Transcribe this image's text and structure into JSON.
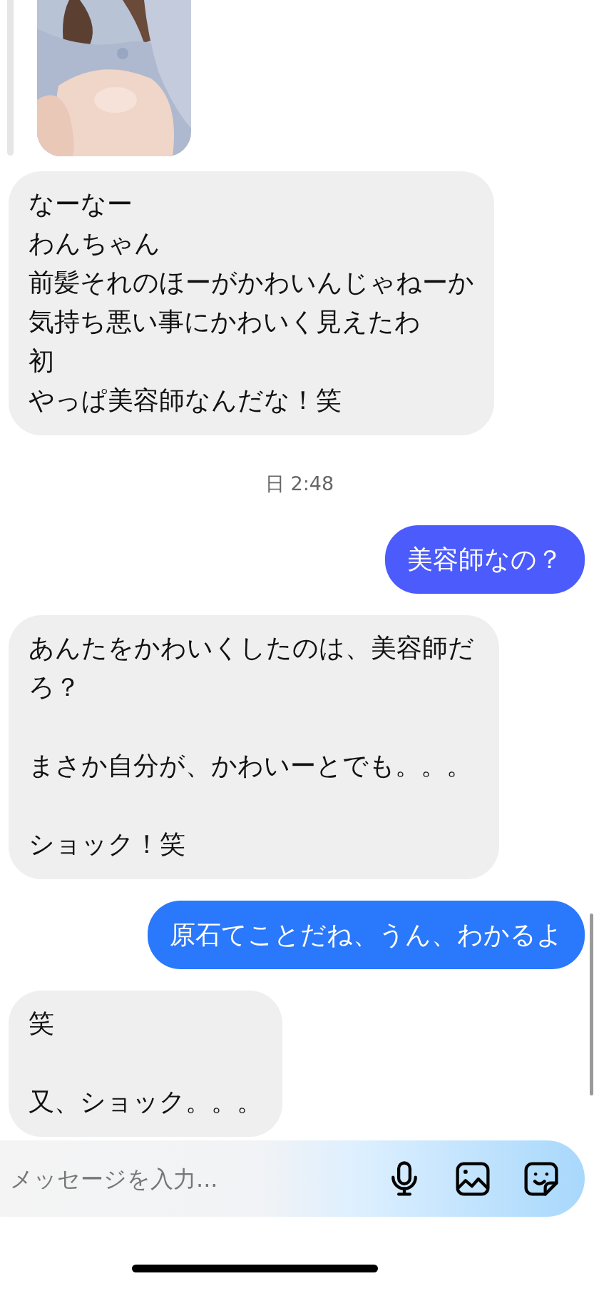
{
  "messages": [
    {
      "kind": "picture"
    },
    {
      "kind": "received",
      "paragraphs": [
        [
          "なーなー",
          "わんちゃん",
          "前髪それのほーがかわいんじゃねーか",
          "気持ち悪い事にかわいく見えたわ",
          "初",
          "やっぱ美容師なんだな！笑"
        ]
      ]
    },
    {
      "kind": "timestamp",
      "text": "日 2:48"
    },
    {
      "kind": "sent",
      "text": "美容師なの？",
      "color": "#4b5bfc"
    },
    {
      "kind": "received",
      "paragraphs": [
        [
          "あんたをかわいくしたのは、美容師だろ？"
        ],
        [
          "まさか自分が、かわいーとでも。。。"
        ],
        [
          "ショック！笑"
        ]
      ]
    },
    {
      "kind": "sent",
      "text": "原石てことだね、うん、わかるよ",
      "color": "#2a78fc"
    },
    {
      "kind": "received",
      "paragraphs": [
        [
          "笑"
        ],
        [
          "又、ショック。。。"
        ]
      ]
    }
  ],
  "composer": {
    "placeholder": "メッセージを入力..."
  }
}
